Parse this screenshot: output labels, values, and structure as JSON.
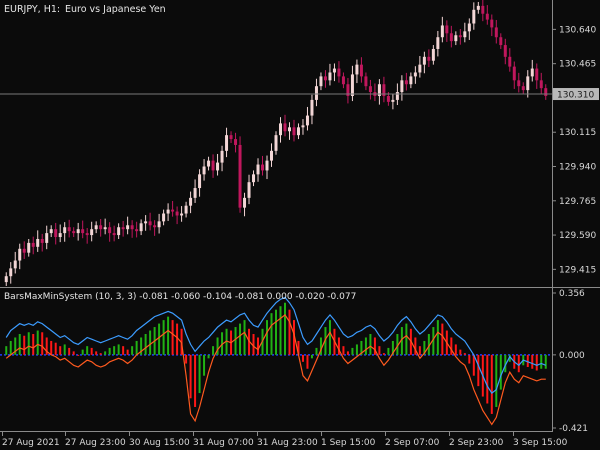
{
  "header": {
    "symbol_timeframe": "EURJPY, H1:",
    "instrument_name": "Euro vs Japanese Yen"
  },
  "colors": {
    "background": "#0b0b0b",
    "axis": "#8a8a8a",
    "bull_candle": "#f3d6d6",
    "bear_candle": "#c0175d",
    "price_line": "#7a7a7a",
    "price_label_bg": "#b9b9b9",
    "ind_upper_line": "#3c9cff",
    "ind_lower_line": "#ff5a1f",
    "ind_zero_line": "#1f3cff",
    "ind_bar_green": "#21b214",
    "ind_bar_red": "#ff1717"
  },
  "price_axis": {
    "ticks": [
      "130.640",
      "130.465",
      "130.115",
      "129.940",
      "129.765",
      "129.590",
      "129.415"
    ],
    "current_price": "130.310"
  },
  "indicator": {
    "title": "BarsMaxMinSystem (10, 3, 3) -0.081 -0.060 -0.104 -0.081 0.000 -0.020 -0.077",
    "ticks": [
      "0.356",
      "0.000",
      "-0.421"
    ]
  },
  "time_axis": {
    "labels": [
      "27 Aug 2021",
      "27 Aug 23:00",
      "30 Aug 15:00",
      "31 Aug 07:00",
      "31 Aug 23:00",
      "1 Sep 15:00",
      "2 Sep 07:00",
      "2 Sep 23:00",
      "3 Sep 15:00"
    ]
  },
  "chart_data": [
    {
      "type": "candlestick",
      "title": "EURJPY, H1: Euro vs Japanese Yen",
      "ylim": [
        129.33,
        130.79
      ],
      "y_ticks": [
        130.64,
        130.465,
        130.115,
        129.94,
        129.765,
        129.59,
        129.415
      ],
      "current_price": 130.31,
      "x_labels": [
        "27 Aug 2021",
        "27 Aug 23:00",
        "30 Aug 15:00",
        "31 Aug 07:00",
        "31 Aug 23:00",
        "1 Sep 15:00",
        "2 Sep 07:00",
        "2 Sep 23:00",
        "3 Sep 15:00"
      ],
      "close": [
        129.38,
        129.42,
        129.46,
        129.52,
        129.5,
        129.55,
        129.53,
        129.57,
        129.55,
        129.6,
        129.62,
        129.58,
        129.6,
        129.63,
        129.61,
        129.6,
        129.62,
        129.6,
        129.59,
        129.62,
        129.64,
        129.62,
        129.63,
        129.6,
        129.59,
        129.63,
        129.62,
        129.64,
        129.62,
        129.61,
        129.65,
        129.66,
        129.64,
        129.63,
        129.66,
        129.7,
        129.72,
        129.71,
        129.69,
        129.7,
        129.74,
        129.78,
        129.83,
        129.9,
        129.94,
        129.97,
        129.92,
        129.96,
        130.02,
        130.1,
        130.08,
        130.05,
        129.73,
        129.78,
        129.86,
        129.9,
        129.95,
        129.92,
        129.97,
        130.02,
        130.1,
        130.16,
        130.12,
        130.14,
        130.1,
        130.14,
        130.15,
        130.2,
        130.28,
        130.35,
        130.4,
        130.38,
        130.42,
        130.44,
        130.4,
        130.36,
        130.3,
        130.41,
        130.46,
        130.4,
        130.35,
        130.32,
        130.3,
        130.36,
        130.3,
        130.27,
        130.28,
        130.32,
        130.38,
        130.36,
        130.4,
        130.42,
        130.46,
        130.5,
        130.48,
        130.54,
        130.6,
        130.66,
        130.62,
        130.58,
        130.61,
        130.6,
        130.63,
        130.67,
        130.74,
        130.76,
        130.72,
        130.69,
        130.65,
        130.6,
        130.56,
        130.5,
        130.45,
        130.38,
        130.35,
        130.33,
        130.4,
        130.44,
        130.38,
        130.34,
        130.3
      ],
      "open_offset_note": "",
      "ind_ylim": [
        -0.421,
        0.356
      ]
    },
    {
      "type": "oscillator",
      "title": "BarsMaxMinSystem (10, 3, 3) -0.081 -0.060 -0.104 -0.081 0.000 -0.020 -0.077",
      "ylim": [
        -0.421,
        0.356
      ],
      "y_ticks": [
        0.356,
        0.0,
        -0.421
      ],
      "series": [
        {
          "values": [
            0.05,
            0.08,
            0.1,
            0.12,
            0.11,
            0.13,
            0.12,
            0.14,
            0.13,
            0.1,
            0.08,
            0.07,
            0.05,
            0.06,
            0.04,
            0.02,
            0.0,
            0.03,
            0.05,
            0.04,
            0.02,
            0.01,
            0.02,
            0.04,
            0.05,
            0.06,
            0.05,
            0.03,
            0.05,
            0.08,
            0.1,
            0.12,
            0.14,
            0.16,
            0.18,
            0.2,
            0.22,
            0.2,
            0.18,
            0.15,
            -0.05,
            -0.25,
            -0.3,
            -0.22,
            -0.12,
            -0.02,
            0.05,
            0.1,
            0.13,
            0.15,
            0.14,
            0.16,
            0.18,
            0.2,
            0.15,
            0.12,
            0.1,
            0.15,
            0.2,
            0.24,
            0.26,
            0.28,
            0.3,
            0.26,
            0.2,
            0.08,
            -0.04,
            -0.08,
            -0.02,
            0.04,
            0.1,
            0.16,
            0.2,
            0.15,
            0.1,
            0.05,
            0.02,
            0.04,
            0.06,
            0.08,
            0.1,
            0.12,
            0.1,
            0.05,
            0.01,
            0.04,
            0.08,
            0.12,
            0.16,
            0.18,
            0.15,
            0.1,
            0.05,
            0.08,
            0.12,
            0.16,
            0.2,
            0.18,
            0.14,
            0.1,
            0.06,
            0.03,
            0.01,
            -0.05,
            -0.12,
            -0.18,
            -0.24,
            -0.28,
            -0.34,
            -0.3,
            -0.2,
            -0.1,
            -0.04,
            -0.08,
            -0.1,
            -0.06,
            -0.07,
            -0.08,
            -0.09,
            -0.08,
            -0.08
          ]
        },
        {
          "values": [
            0.1,
            0.14,
            0.16,
            0.18,
            0.17,
            0.18,
            0.17,
            0.19,
            0.18,
            0.16,
            0.14,
            0.12,
            0.1,
            0.11,
            0.09,
            0.07,
            0.06,
            0.08,
            0.1,
            0.09,
            0.08,
            0.07,
            0.08,
            0.09,
            0.1,
            0.11,
            0.1,
            0.09,
            0.11,
            0.14,
            0.16,
            0.18,
            0.2,
            0.22,
            0.23,
            0.24,
            0.25,
            0.24,
            0.22,
            0.2,
            0.12,
            0.06,
            0.02,
            0.05,
            0.08,
            0.1,
            0.13,
            0.16,
            0.18,
            0.2,
            0.19,
            0.21,
            0.23,
            0.24,
            0.2,
            0.17,
            0.16,
            0.2,
            0.24,
            0.27,
            0.3,
            0.32,
            0.33,
            0.3,
            0.26,
            0.18,
            0.1,
            0.06,
            0.08,
            0.12,
            0.16,
            0.2,
            0.23,
            0.2,
            0.16,
            0.12,
            0.1,
            0.11,
            0.13,
            0.14,
            0.16,
            0.17,
            0.15,
            0.11,
            0.08,
            0.1,
            0.13,
            0.17,
            0.2,
            0.22,
            0.19,
            0.15,
            0.12,
            0.14,
            0.17,
            0.2,
            0.23,
            0.22,
            0.19,
            0.15,
            0.12,
            0.1,
            0.08,
            0.04,
            0.0,
            -0.06,
            -0.12,
            -0.18,
            -0.22,
            -0.2,
            -0.12,
            -0.06,
            -0.01,
            -0.04,
            -0.06,
            -0.03,
            -0.04,
            -0.05,
            -0.06,
            -0.05,
            -0.06
          ]
        },
        {
          "values": [
            -0.02,
            0.0,
            0.02,
            0.04,
            0.03,
            0.05,
            0.04,
            0.06,
            0.05,
            0.02,
            0.0,
            -0.01,
            -0.03,
            -0.02,
            -0.04,
            -0.06,
            -0.07,
            -0.05,
            -0.03,
            -0.04,
            -0.06,
            -0.07,
            -0.06,
            -0.04,
            -0.03,
            -0.02,
            -0.03,
            -0.05,
            -0.03,
            0.0,
            0.02,
            0.04,
            0.06,
            0.08,
            0.1,
            0.12,
            0.14,
            0.12,
            0.1,
            0.07,
            -0.12,
            -0.34,
            -0.38,
            -0.3,
            -0.2,
            -0.1,
            -0.02,
            0.03,
            0.06,
            0.08,
            0.07,
            0.09,
            0.11,
            0.13,
            0.08,
            0.05,
            0.03,
            0.08,
            0.13,
            0.17,
            0.19,
            0.21,
            0.23,
            0.19,
            0.12,
            0.0,
            -0.12,
            -0.15,
            -0.09,
            -0.03,
            0.03,
            0.09,
            0.13,
            0.08,
            0.03,
            -0.02,
            -0.05,
            -0.03,
            -0.01,
            0.01,
            0.03,
            0.05,
            0.03,
            -0.02,
            -0.06,
            -0.03,
            0.01,
            0.05,
            0.09,
            0.11,
            0.08,
            0.03,
            -0.02,
            0.01,
            0.05,
            0.09,
            0.13,
            0.11,
            0.07,
            0.03,
            -0.01,
            -0.04,
            -0.06,
            -0.12,
            -0.2,
            -0.26,
            -0.32,
            -0.36,
            -0.4,
            -0.36,
            -0.26,
            -0.16,
            -0.1,
            -0.14,
            -0.16,
            -0.12,
            -0.13,
            -0.14,
            -0.15,
            -0.14,
            -0.14
          ]
        }
      ]
    }
  ]
}
